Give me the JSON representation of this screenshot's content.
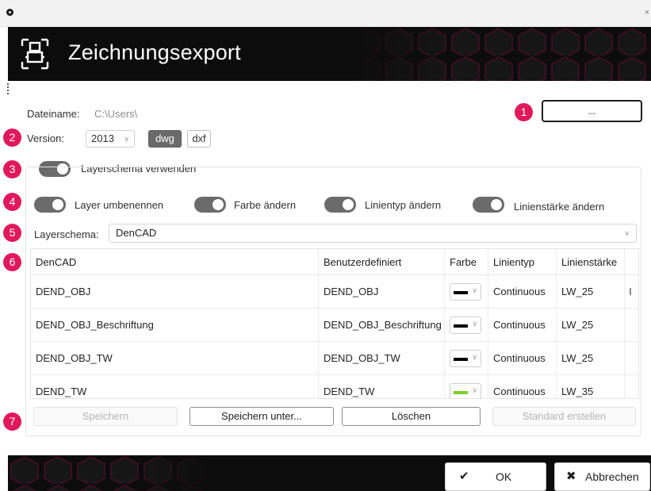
{
  "window": {
    "close_glyph": "×"
  },
  "header": {
    "title": "Zeichnungsexport",
    "logo_icon": "drawing-export-icon"
  },
  "badges": [
    "1",
    "2",
    "3",
    "4",
    "5",
    "6",
    "7"
  ],
  "file": {
    "label": "Dateiname:",
    "value": "C:\\Users\\",
    "browse_label": "..."
  },
  "version": {
    "label": "Version:",
    "selected": "2013",
    "formats": [
      {
        "label": "dwg",
        "active": true
      },
      {
        "label": "dxf",
        "active": false
      }
    ]
  },
  "toggles": {
    "use_schema": {
      "label": "Layerschema verwenden",
      "on": true
    },
    "rename_layer": {
      "label": "Layer umbenennen",
      "on": true
    },
    "change_color": {
      "label": "Farbe ändern",
      "on": true
    },
    "change_linetype": {
      "label": "Linientyp ändern",
      "on": true
    },
    "change_lineweight": {
      "label": "Linienstärke ändern",
      "on": true
    }
  },
  "schema": {
    "label": "Layerschema:",
    "selected": "DenCAD"
  },
  "table": {
    "columns": [
      "DenCAD",
      "Benutzerdefiniert",
      "Farbe",
      "Linientyp",
      "Linienstärke"
    ],
    "rows": [
      {
        "dencad": "DEND_OBJ",
        "custom": "DEND_OBJ",
        "color": "#000000",
        "linetype": "Continuous",
        "lineweight": "LW_25"
      },
      {
        "dencad": "DEND_OBJ_Beschriftung",
        "custom": "DEND_OBJ_Beschriftung",
        "color": "#000000",
        "linetype": "Continuous",
        "lineweight": "LW_25"
      },
      {
        "dencad": "DEND_OBJ_TW",
        "custom": "DEND_OBJ_TW",
        "color": "#000000",
        "linetype": "Continuous",
        "lineweight": "LW_25"
      },
      {
        "dencad": "DEND_TW",
        "custom": "DEND_TW",
        "color": "#7ccf2a",
        "linetype": "Continuous",
        "lineweight": "LW_35"
      }
    ]
  },
  "actions": {
    "save": "Speichern",
    "save_as": "Speichern unter...",
    "delete": "Löschen",
    "make_default": "Standard erstellen"
  },
  "footer": {
    "ok": "OK",
    "ok_icon": "checkmark-icon",
    "cancel": "Abbrechen",
    "cancel_icon": "x-icon"
  },
  "colors": {
    "accent_badge": "#e0195c",
    "header_bg": "#0c0c0c",
    "hex_outline": "#3a0f22",
    "toggle_on": "#6b6b6b"
  }
}
